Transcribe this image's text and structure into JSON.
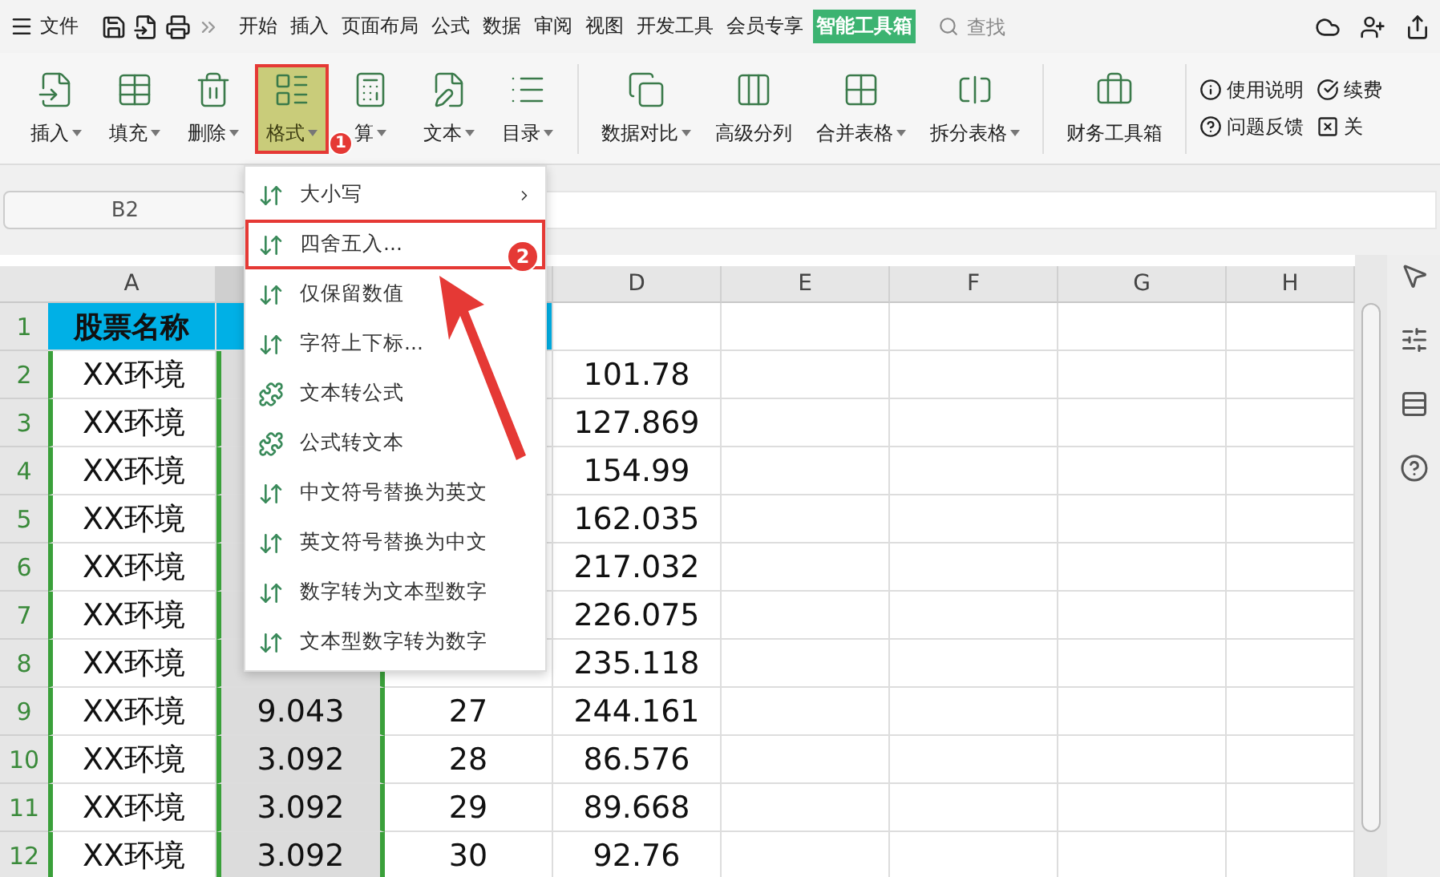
{
  "menubar": {
    "file": "文件",
    "tabs": [
      {
        "label": "开始",
        "selected": false
      },
      {
        "label": "插入",
        "selected": false
      },
      {
        "label": "页面布局",
        "selected": false
      },
      {
        "label": "公式",
        "selected": false
      },
      {
        "label": "数据",
        "selected": false
      },
      {
        "label": "审阅",
        "selected": false
      },
      {
        "label": "视图",
        "selected": false
      },
      {
        "label": "开发工具",
        "selected": false
      },
      {
        "label": "会员专享",
        "selected": false
      },
      {
        "label": "智能工具箱",
        "selected": true
      }
    ],
    "search": {
      "placeholder": "查找"
    }
  },
  "ribbon": {
    "groups": [
      [
        {
          "label": "插入",
          "dropdown": true,
          "selected": false
        },
        {
          "label": "填充",
          "dropdown": true,
          "selected": false
        },
        {
          "label": "删除",
          "dropdown": true,
          "selected": false
        },
        {
          "label": "格式",
          "dropdown": true,
          "selected": true
        },
        {
          "label": "算",
          "dropdown": true,
          "selected": false
        },
        {
          "label": "文本",
          "dropdown": true,
          "selected": false
        },
        {
          "label": "目录",
          "dropdown": true,
          "selected": false
        }
      ],
      [
        {
          "label": "数据对比",
          "dropdown": true,
          "selected": false
        },
        {
          "label": "高级分列",
          "dropdown": false,
          "selected": false
        },
        {
          "label": "合并表格",
          "dropdown": true,
          "selected": false
        },
        {
          "label": "拆分表格",
          "dropdown": true,
          "selected": false
        }
      ],
      [
        {
          "label": "财务工具箱",
          "dropdown": false,
          "selected": false
        }
      ]
    ],
    "small": [
      {
        "label": "使用说明"
      },
      {
        "label": "续费"
      },
      {
        "label": "问题反馈"
      },
      {
        "label": "关"
      }
    ]
  },
  "name_box": "B2",
  "sheet": {
    "columns": [
      {
        "label": "A",
        "selected": false
      },
      {
        "selected": true
      },
      {
        "selected": false
      },
      {
        "label": "D",
        "selected": false
      },
      {
        "label": "E",
        "selected": false
      },
      {
        "label": "F",
        "selected": false
      },
      {
        "label": "G",
        "selected": false
      },
      {
        "label": "H",
        "selected": false
      }
    ],
    "rows": [
      {
        "number": "1",
        "kind": "header",
        "cells": [
          "股票名称",
          null,
          null,
          null
        ]
      },
      {
        "number": "2",
        "kind": "data",
        "cells": [
          "XX环境",
          null,
          null,
          "101.78"
        ]
      },
      {
        "number": "3",
        "kind": "data",
        "cells": [
          "XX环境",
          null,
          null,
          "127.869"
        ]
      },
      {
        "number": "4",
        "kind": "data",
        "cells": [
          "XX环境",
          null,
          null,
          "154.99"
        ]
      },
      {
        "number": "5",
        "kind": "data",
        "cells": [
          "XX环境",
          null,
          null,
          "162.035"
        ]
      },
      {
        "number": "6",
        "kind": "data",
        "cells": [
          "XX环境",
          null,
          null,
          "217.032"
        ]
      },
      {
        "number": "7",
        "kind": "data",
        "cells": [
          "XX环境",
          null,
          null,
          "226.075"
        ]
      },
      {
        "number": "8",
        "kind": "data",
        "cells": [
          "XX环境",
          null,
          null,
          "235.118"
        ]
      },
      {
        "number": "9",
        "kind": "data",
        "cells": [
          "XX环境",
          "9.043",
          "27",
          "244.161"
        ]
      },
      {
        "number": "10",
        "kind": "data",
        "cells": [
          "XX环境",
          "3.092",
          "28",
          "86.576"
        ]
      },
      {
        "number": "11",
        "kind": "data",
        "cells": [
          "XX环境",
          "3.092",
          "29",
          "89.668"
        ]
      },
      {
        "number": "12",
        "kind": "data",
        "cells": [
          "XX环境",
          "3.092",
          "30",
          "92.76"
        ]
      }
    ]
  },
  "context_menu": {
    "items": [
      {
        "label": "大小写",
        "submenu": true,
        "highlighted": false
      },
      {
        "label": "四舍五入...",
        "submenu": false,
        "highlighted": true
      },
      {
        "label": "仅保留数值",
        "submenu": false,
        "highlighted": false
      },
      {
        "label": "字符上下标...",
        "submenu": false,
        "highlighted": false
      },
      {
        "label": "文本转公式",
        "submenu": false,
        "highlighted": false
      },
      {
        "label": "公式转文本",
        "submenu": false,
        "highlighted": false
      },
      {
        "label": "中文符号替换为英文",
        "submenu": false,
        "highlighted": false
      },
      {
        "label": "英文符号替换为中文",
        "submenu": false,
        "highlighted": false
      },
      {
        "label": "数字转为文本型数字",
        "submenu": false,
        "highlighted": false
      },
      {
        "label": "文本型数字转为数字",
        "submenu": false,
        "highlighted": false
      }
    ]
  },
  "annotations": [
    "1",
    "2"
  ]
}
